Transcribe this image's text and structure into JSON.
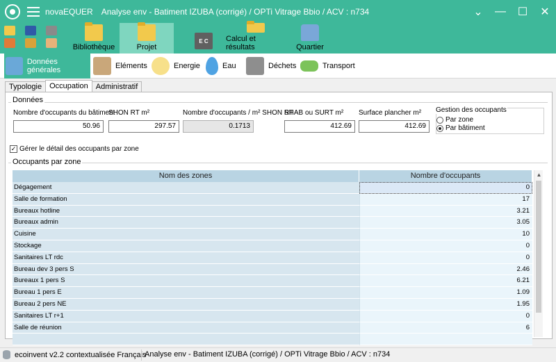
{
  "app": {
    "name": "novaEQUER",
    "title": "Analyse env - Batiment  IZUBA (corrigé) / OPTi Vitrage Bbio / ACV : n734",
    "window_controls": [
      "chevron-down",
      "minimize",
      "maximize",
      "close"
    ]
  },
  "colors": {
    "accent": "#3eb89a",
    "accent_light": "#7fd6bf",
    "table_header": "#b9d4e3",
    "table_name_cell": "#d7e6ef",
    "table_value_cell": "#eaf5fb"
  },
  "toolbar": {
    "small_tools": [
      "open-folder-icon",
      "save-icon",
      "tools-icon",
      "home-icon",
      "settings-icon",
      "hand-icon"
    ],
    "buttons": [
      {
        "label": "Bibliothèque",
        "icon": "folder-library-icon",
        "active": false,
        "enabled": true
      },
      {
        "label": "Projet",
        "icon": "folder-project-icon",
        "active": true,
        "enabled": true
      },
      {
        "label": "",
        "icon": "ec-ec-icon",
        "active": false,
        "enabled": false
      },
      {
        "label": "Calcul et résultats",
        "icon": "folder-results-icon",
        "active": false,
        "enabled": true
      },
      {
        "label": "Quartier",
        "icon": "quartier-icon",
        "active": false,
        "enabled": true
      }
    ]
  },
  "modules": [
    {
      "label": "Données générales",
      "icon": "general-data-icon",
      "active": true
    },
    {
      "label": "Eléments",
      "icon": "house-icon",
      "active": false
    },
    {
      "label": "Energie",
      "icon": "bulb-icon",
      "active": false
    },
    {
      "label": "Eau",
      "icon": "water-drop-icon",
      "active": false
    },
    {
      "label": "Déchets",
      "icon": "bin-icon",
      "active": false
    },
    {
      "label": "Transport",
      "icon": "car-icon",
      "active": false
    }
  ],
  "subtabs": [
    {
      "label": "Typologie",
      "active": false
    },
    {
      "label": "Occupation",
      "active": true
    },
    {
      "label": "Administratif",
      "active": false
    }
  ],
  "donnees": {
    "group_label": "Données",
    "fields": [
      {
        "label": "Nombre d'occupants du bâtiment",
        "value": "50.96",
        "readonly": false
      },
      {
        "label": "SHON RT m²",
        "value": "297.57",
        "readonly": false
      },
      {
        "label": "Nombre d'occupants / m² SHON RT",
        "value": "0.1713",
        "readonly": true
      },
      {
        "label": "SHAB ou SURT m²",
        "value": "412.69",
        "readonly": false
      },
      {
        "label": "Surface plancher m²",
        "value": "412.69",
        "readonly": false
      }
    ],
    "gestion": {
      "label": "Gestion des occupants",
      "options": [
        {
          "label": "Par zone",
          "checked": false
        },
        {
          "label": "Par bâtiment",
          "checked": true
        }
      ]
    }
  },
  "detail_checkbox": {
    "label": "Gérer le détail des occupants par zone",
    "checked": true
  },
  "zones": {
    "group_label": "Occupants par zone",
    "columns": [
      "Nom des zones",
      "Nombre d'occupants"
    ],
    "rows": [
      {
        "name": "Dégagement",
        "value": "0"
      },
      {
        "name": "Salle de formation",
        "value": "17"
      },
      {
        "name": "Bureaux hotline",
        "value": "3.21"
      },
      {
        "name": "Bureaux admin",
        "value": "3.05"
      },
      {
        "name": "Cuisine",
        "value": "10"
      },
      {
        "name": "Stockage",
        "value": "0"
      },
      {
        "name": "Sanitaires LT rdc",
        "value": "0"
      },
      {
        "name": "Bureau dev 3 pers S",
        "value": "2.46"
      },
      {
        "name": "Bureaux 1 pers S",
        "value": "6.21"
      },
      {
        "name": "Bureau 1 pers E",
        "value": "1.09"
      },
      {
        "name": "Bureau 2 pers NE",
        "value": "1.95"
      },
      {
        "name": "Sanitaires LT r+1",
        "value": "0"
      },
      {
        "name": "Salle de réunion",
        "value": "6"
      },
      {
        "name": "",
        "value": ""
      }
    ]
  },
  "statusbar": {
    "database": "ecoinvent v2.2 contextualisée Français",
    "project": "Analyse env - Batiment  IZUBA (corrigé) / OPTi Vitrage Bbio / ACV : n734"
  }
}
